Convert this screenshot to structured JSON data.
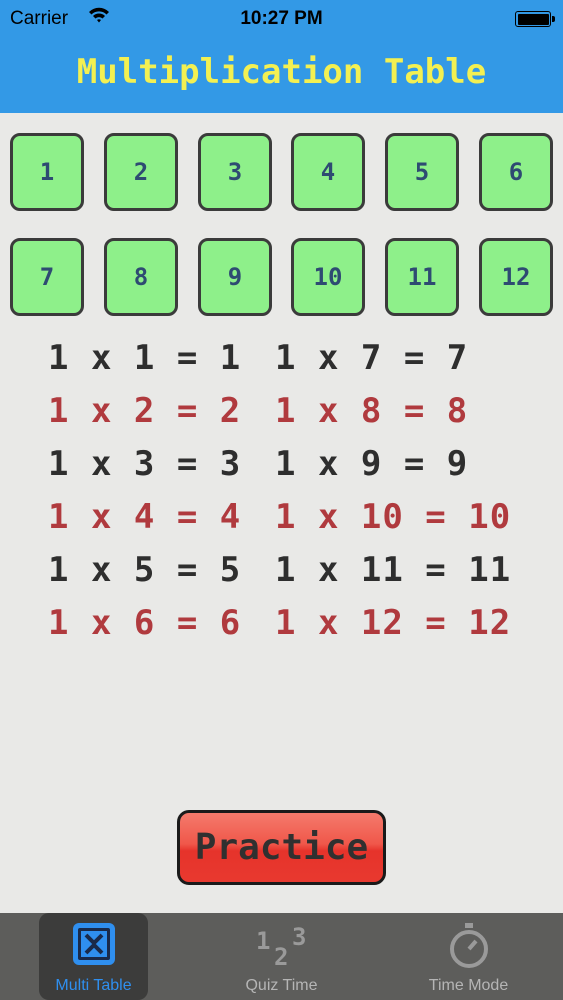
{
  "status_bar": {
    "carrier": "Carrier",
    "time": "10:27 PM"
  },
  "header": {
    "title": "Multiplication Table"
  },
  "numbers": [
    "1",
    "2",
    "3",
    "4",
    "5",
    "6",
    "7",
    "8",
    "9",
    "10",
    "11",
    "12"
  ],
  "equations_left": [
    "1 x 1 = 1",
    "1 x 2 = 2",
    "1 x 3 = 3",
    "1 x 4 = 4",
    "1 x 5 = 5",
    "1 x 6 = 6"
  ],
  "equations_right": [
    "1 x 7 = 7",
    "1 x 8 = 8",
    "1 x 9 = 9",
    "1 x 10 = 10",
    "1 x 11 = 11",
    "1 x 12 = 12"
  ],
  "practice_label": "Practice",
  "tabs": [
    {
      "label": "Multi Table",
      "icon": "x-box-icon",
      "active": true
    },
    {
      "label": "Quiz Time",
      "icon": "123-icon",
      "active": false
    },
    {
      "label": "Time Mode",
      "icon": "stopwatch-icon",
      "active": false
    }
  ],
  "colors": {
    "header": "#3399e6",
    "title": "#f3f052",
    "button_green": "#8ef08a",
    "equation_dark": "#2e2e2e",
    "equation_red": "#b03a3e",
    "practice_red": "#e8392f",
    "tabbar": "#5d5d5b",
    "tab_active": "#2f8fef"
  }
}
